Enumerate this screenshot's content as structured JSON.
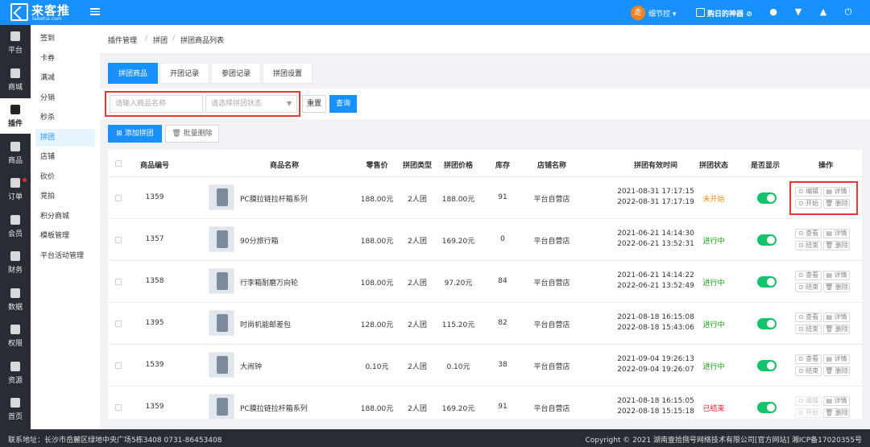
{
  "brand": {
    "title": "来客推",
    "subtitle": "laiketui.com"
  },
  "header": {
    "user_avatar_char": "走",
    "user_name": "细节控",
    "shop_name": "购日的神器"
  },
  "left_nav": [
    {
      "label": "平台",
      "icon": "platform-icon"
    },
    {
      "label": "商城",
      "icon": "mall-icon"
    },
    {
      "label": "插件",
      "icon": "plugin-icon",
      "active": true
    },
    {
      "label": "商品",
      "icon": "goods-icon"
    },
    {
      "label": "订单",
      "icon": "order-icon",
      "badge": true
    },
    {
      "label": "会员",
      "icon": "member-icon"
    },
    {
      "label": "财务",
      "icon": "finance-icon"
    },
    {
      "label": "数据",
      "icon": "data-icon"
    },
    {
      "label": "权限",
      "icon": "permission-icon"
    },
    {
      "label": "资源",
      "icon": "resource-icon"
    },
    {
      "label": "首页",
      "icon": "home-icon"
    }
  ],
  "sub_nav": [
    "签到",
    "卡券",
    "满减",
    "分销",
    "秒杀",
    "拼团",
    "店铺",
    "砍价",
    "竞拍",
    "积分商城",
    "模板管理",
    "平台活动管理"
  ],
  "breadcrumb": [
    "插件管理",
    "拼团",
    "拼团商品列表"
  ],
  "tabs": [
    "拼团商品",
    "开团记录",
    "参团记录",
    "拼团设置"
  ],
  "filter": {
    "name_placeholder": "请输入商品名称",
    "status_placeholder": "请选择拼团状态",
    "reset_label": "重置",
    "query_label": "查询"
  },
  "toolbar": {
    "add_label": "添加拼团",
    "batch_delete_label": "批量删除"
  },
  "table": {
    "headers": [
      "商品编号",
      "商品名称",
      "零售价",
      "拼团类型",
      "拼团价格",
      "库存",
      "店铺名称",
      "拼团有效时间",
      "拼团状态",
      "是否显示",
      "操作"
    ],
    "rows": [
      {
        "id": "1359",
        "name": "PC膜拉链拉杆箱系列",
        "retail": "188.00元",
        "type": "2人团",
        "price": "188.00元",
        "stock": "91",
        "shop": "平台自营店",
        "start": "2021-08-31 17:17:15",
        "end": "2022-08-31 17:17:19",
        "status": "未开始",
        "ops": [
          "编辑",
          "详情",
          "开始",
          "删除"
        ]
      },
      {
        "id": "1357",
        "name": "90分旅行箱",
        "retail": "188.00元",
        "type": "2人团",
        "price": "169.20元",
        "stock": "0",
        "shop": "平台自营店",
        "start": "2021-06-21 14:14:30",
        "end": "2022-06-21 13:52:31",
        "status": "进行中",
        "ops": [
          "查看",
          "详情",
          "结束",
          "删除"
        ]
      },
      {
        "id": "1358",
        "name": "行李箱耐磨万向轮",
        "retail": "108.00元",
        "type": "2人团",
        "price": "97.20元",
        "stock": "84",
        "shop": "平台自营店",
        "start": "2021-06-21 14:14:22",
        "end": "2022-06-21 13:52:49",
        "status": "进行中",
        "ops": [
          "查看",
          "详情",
          "结束",
          "删除"
        ]
      },
      {
        "id": "1395",
        "name": "时尚机能邮差包",
        "retail": "128.00元",
        "type": "2人团",
        "price": "115.20元",
        "stock": "82",
        "shop": "平台自营店",
        "start": "2021-08-18 16:15:08",
        "end": "2022-08-18 15:43:06",
        "status": "进行中",
        "ops": [
          "查看",
          "详情",
          "结束",
          "删除"
        ]
      },
      {
        "id": "1539",
        "name": "大闹钟",
        "retail": "0.10元",
        "type": "2人团",
        "price": "0.10元",
        "stock": "38",
        "shop": "平台自营店",
        "start": "2021-09-04 19:26:13",
        "end": "2022-09-04 19:26:07",
        "status": "进行中",
        "ops": [
          "查看",
          "详情",
          "结束",
          "删除"
        ]
      },
      {
        "id": "1359",
        "name": "PC膜拉链拉杆箱系列",
        "retail": "188.00元",
        "type": "2人团",
        "price": "169.20元",
        "stock": "91",
        "shop": "平台自营店",
        "start": "2021-08-18 16:15:05",
        "end": "2022-08-18 15:15:18",
        "status": "已结束",
        "ops": [
          "编辑",
          "详情",
          "开始",
          "删除"
        ]
      }
    ]
  },
  "footer": {
    "address": "联系地址：长沙市岳麓区绿地中央广场5栋3408 0731-86453408",
    "copyright": "Copyright © 2021 湖南壹拾捌号网络技术有限公司[官方网站]  湘ICP备17020355号"
  },
  "colors": {
    "primary": "#1890ff",
    "nav_bg": "#282c34",
    "not_started": "#fa8c16",
    "running": "#13a10e",
    "ended": "#f5222d",
    "toggle_on": "#13c26b",
    "highlight": "#e53935"
  }
}
